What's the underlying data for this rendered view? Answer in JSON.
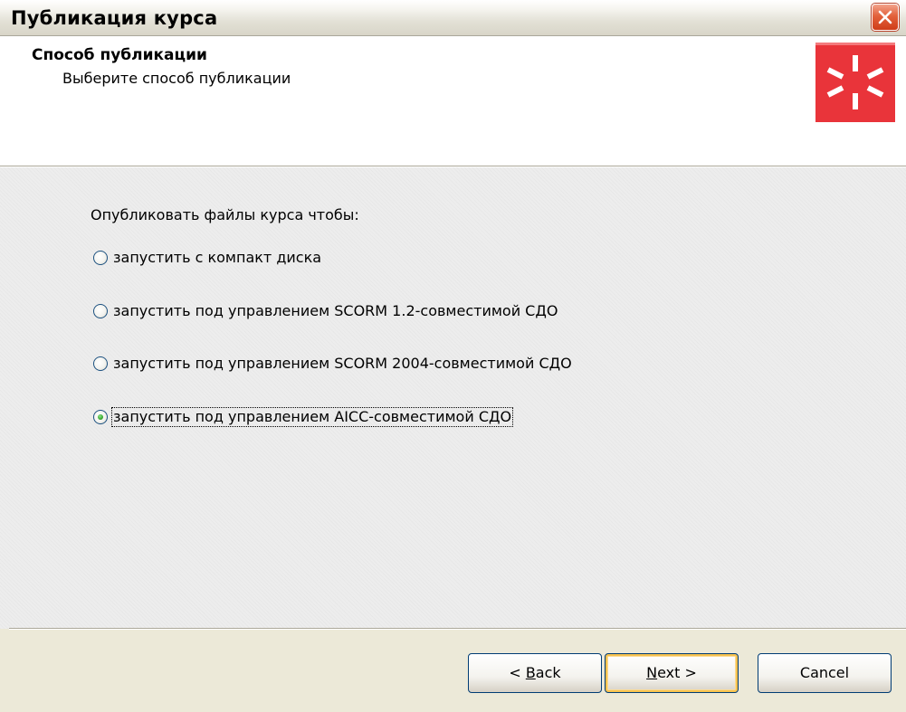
{
  "window": {
    "title": "Публикация курса"
  },
  "header": {
    "title": "Способ публикации",
    "subtitle": "Выберите способ публикации",
    "logo_icon": "asterisk-burst-icon",
    "logo_color": "#e9343a"
  },
  "content": {
    "prompt": "Опубликовать файлы курса чтобы:",
    "options": [
      {
        "label": "запустить с компакт диска",
        "selected": false
      },
      {
        "label": "запустить под управлением SCORM 1.2-совместимой СДО",
        "selected": false
      },
      {
        "label": "запустить под управлением SCORM 2004-совместимой СДО",
        "selected": false
      },
      {
        "label": "запустить под управлением AICC-совместимой СДО",
        "selected": true
      }
    ]
  },
  "buttons": {
    "back": {
      "prefix": "< ",
      "accel": "B",
      "rest": "ack"
    },
    "next": {
      "accel": "N",
      "rest": "ext >"
    },
    "cancel": "Cancel"
  },
  "colors": {
    "selected_dot": "#3fae35",
    "default_button_glow": "#f6c24e"
  }
}
